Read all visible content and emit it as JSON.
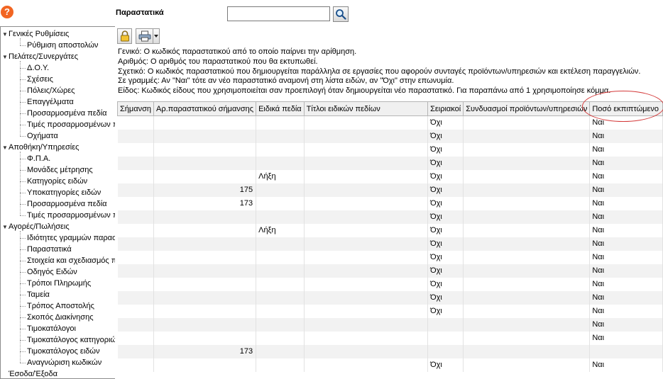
{
  "header": {
    "title": "Παραστατικά",
    "search_value": "",
    "search_placeholder": ""
  },
  "help_glyph": "?",
  "icons": {
    "help": "help-icon",
    "search": "search-icon",
    "lock": "lock-icon",
    "print": "print-icon",
    "dropdown": "chevron-down-icon"
  },
  "colors": {
    "help": "#f26522",
    "annotation_ellipse": "#d43a3a",
    "header_bg": "#f0f0f0",
    "alt_row": "#f2f2f2"
  },
  "sidebar": {
    "groups": [
      {
        "label": "Γενικές Ρυθμίσεις",
        "items": [
          "Ρύθμιση αποστολών"
        ]
      },
      {
        "label": "Πελάτες/Συνεργάτες",
        "items": [
          "Δ.Ο.Υ.",
          "Σχέσεις",
          "Πόλεις/Χώρες",
          "Επαγγέλματα",
          "Προσαρμοσμένα πεδία",
          "Τιμές προσαρμοσμένων πεδ",
          "Οχήματα"
        ]
      },
      {
        "label": "Αποθήκη/Υπηρεσίες",
        "items": [
          "Φ.Π.Α.",
          "Μονάδες μέτρησης",
          "Κατηγορίες ειδών",
          "Υποκατηγορίες ειδών",
          "Προσαρμοσμένα πεδία",
          "Τιμές προσαρμοσμένων πεδ"
        ]
      },
      {
        "label": "Αγορές/Πωλήσεις",
        "items": [
          "Ιδιότητες γραμμών παραστ",
          "Παραστατικά",
          "Στοιχεία και σχεδιασμός πα",
          "Οδηγός Ειδών",
          "Τρόποι Πληρωμής",
          "Ταμεία",
          "Τρόπος Αποστολής",
          "Σκοπός Διακίνησης",
          "Τιμοκατάλογοι",
          "Τιμοκατάλογος κατηγοριώ",
          "Τιμοκατάλογος ειδών",
          "Αναγνώριση κωδικών"
        ]
      },
      {
        "label": "Έσοδα/Έξοδα",
        "items": []
      }
    ]
  },
  "info_lines": [
    "Γενικό: Ο κωδικός παραστατικού από το οποίο παίρνει την αρίθμηση.",
    "Αριθμός: Ο αριθμός του παραστατικού που θα εκτυπωθεί.",
    "Σχετικό: Ο κωδικός παραστατικού που δημιουργείται παράλληλα σε εργασίες που αφορούν συνταγές προϊόντων/υπηρεσιών και εκτέλεση παραγγελιών.",
    "Σε γραμμές: Αν \"Ναι\" τότε αν νέο παραστατικό αναμονή στη λίστα ειδών, αν \"Όχι\" στην επωνυμία.",
    "Είδος: Κωδικός είδους που χρησιμοποιείται σαν προεπιλογή όταν δημιουργείται νέο παραστατικό. Για παραπάνω από 1 χρησιμοποίησε κόμμα."
  ],
  "table": {
    "columns": [
      "Σήμανση",
      "Αρ.παραστατικού σήμανσης",
      "Ειδικά πεδία",
      "Τίτλοι ειδικών πεδίων",
      "Σειριακοί",
      "Συνδυασμοί προϊόντων/υπηρεσιών",
      "Ποσό εκπιπτώμενο"
    ],
    "rows": [
      [
        "",
        "",
        "",
        "",
        "Όχι",
        "",
        "Ναι"
      ],
      [
        "",
        "",
        "",
        "",
        "Όχι",
        "",
        "Ναι"
      ],
      [
        "",
        "",
        "",
        "",
        "Όχι",
        "",
        "Ναι"
      ],
      [
        "",
        "",
        "",
        "",
        "Όχι",
        "",
        "Ναι"
      ],
      [
        "",
        "",
        "Λήξη",
        "",
        "Όχι",
        "",
        "Ναι"
      ],
      [
        "",
        "175",
        "",
        "",
        "Όχι",
        "",
        "Ναι"
      ],
      [
        "",
        "173",
        "",
        "",
        "Όχι",
        "",
        "Ναι"
      ],
      [
        "",
        "",
        "",
        "",
        "Όχι",
        "",
        "Ναι"
      ],
      [
        "",
        "",
        "Λήξη",
        "",
        "Όχι",
        "",
        "Ναι"
      ],
      [
        "",
        "",
        "",
        "",
        "Όχι",
        "",
        "Ναι"
      ],
      [
        "",
        "",
        "",
        "",
        "Όχι",
        "",
        "Ναι"
      ],
      [
        "",
        "",
        "",
        "",
        "Όχι",
        "",
        "Ναι"
      ],
      [
        "",
        "",
        "",
        "",
        "Όχι",
        "",
        "Ναι"
      ],
      [
        "",
        "",
        "",
        "",
        "Όχι",
        "",
        "Ναι"
      ],
      [
        "",
        "",
        "",
        "",
        "Όχι",
        "",
        "Ναι"
      ],
      [
        "",
        "",
        "",
        "",
        "",
        "",
        "Ναι"
      ],
      [
        "",
        "",
        "",
        "",
        "",
        "",
        "Ναι"
      ],
      [
        "",
        "173",
        "",
        "",
        "",
        "",
        ""
      ],
      [
        "",
        "",
        "",
        "",
        "Όχι",
        "",
        "Ναι"
      ]
    ]
  }
}
